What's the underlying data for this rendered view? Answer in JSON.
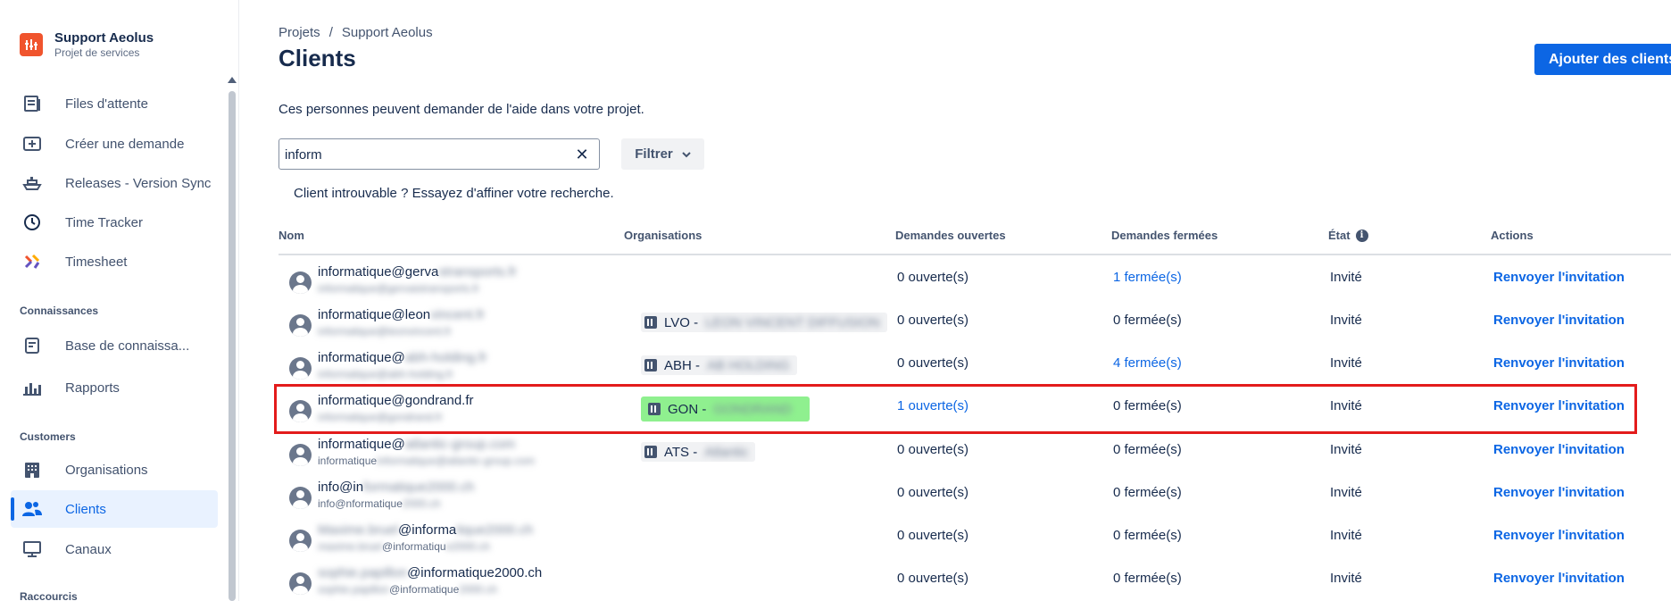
{
  "project": {
    "name": "Support Aeolus",
    "type": "Projet de services"
  },
  "nav": {
    "items_top": [
      {
        "label": "Files d'attente",
        "icon": "queue-icon"
      },
      {
        "label": "Créer une demande",
        "icon": "create-request-icon"
      },
      {
        "label": "Releases - Version Sync",
        "icon": "ship-icon"
      },
      {
        "label": "Time Tracker",
        "icon": "clock-icon"
      },
      {
        "label": "Timesheet",
        "icon": "timesheet-icon"
      }
    ],
    "section_knowledge": "Connaissances",
    "items_knowledge": [
      {
        "label": "Base de connaissa...",
        "icon": "knowledge-base-icon"
      },
      {
        "label": "Rapports",
        "icon": "reports-icon"
      }
    ],
    "section_customers": "Customers",
    "items_customers": [
      {
        "label": "Organisations",
        "icon": "building-icon"
      },
      {
        "label": "Clients",
        "icon": "users-icon"
      },
      {
        "label": "Canaux",
        "icon": "monitor-icon"
      }
    ],
    "section_shortcuts": "Raccourcis"
  },
  "breadcrumb": {
    "root": "Projets",
    "sep": "/",
    "current": "Support Aeolus"
  },
  "page": {
    "title": "Clients",
    "add_button": "Ajouter des clients",
    "description": "Ces personnes peuvent demander de l'aide dans votre projet.",
    "search_value": "inform",
    "filter_label": "Filtrer",
    "not_found": "Client introuvable ? Essayez d'affiner votre recherche."
  },
  "table": {
    "headers": {
      "name": "Nom",
      "orgs": "Organisations",
      "open": "Demandes ouvertes",
      "closed": "Demandes fermées",
      "state": "État",
      "actions": "Actions"
    },
    "rows": [
      {
        "name_visible": "informatique@gerva",
        "name_hidden": "stransports.fr",
        "email_hidden": "informatique@gervaistransports.fr",
        "org_code": "",
        "org_hidden": "",
        "open": "0 ouverte(s)",
        "open_link": false,
        "closed": "1 fermée(s)",
        "closed_link": true,
        "state": "Invité",
        "action": "Renvoyer l'invitation"
      },
      {
        "name_visible": "informatique@leon",
        "name_hidden": "vincent.fr",
        "email_hidden": "informatique@leonvincent.fr",
        "org_code": "LVO -",
        "org_hidden": "LEON VINCENT DIFFUSION",
        "open": "0 ouverte(s)",
        "open_link": false,
        "closed": "0 fermée(s)",
        "closed_link": false,
        "state": "Invité",
        "action": "Renvoyer l'invitation"
      },
      {
        "name_visible": "informatique@",
        "name_hidden": "abh-holding.fr",
        "email_hidden": "informatique@abh-holding.fr",
        "org_code": "ABH -",
        "org_hidden": "AB HOLDING",
        "open": "0 ouverte(s)",
        "open_link": false,
        "closed": "4 fermée(s)",
        "closed_link": true,
        "state": "Invité",
        "action": "Renvoyer l'invitation"
      },
      {
        "name_visible": "informatique@gondrand.fr",
        "name_hidden": "",
        "email_hidden": "informatique@gondrand.fr",
        "org_code": "GON -",
        "org_hidden": "GONDRAND",
        "open": "1 ouverte(s)",
        "open_link": true,
        "closed": "0 fermée(s)",
        "closed_link": false,
        "state": "Invité",
        "action": "Renvoyer l'invitation"
      },
      {
        "name_visible": "informatique@",
        "name_hidden": "atlantic-group.com",
        "email_hidden": "informatique@atlantic-group.com",
        "email_visible": "informatique",
        "org_code": "ATS -",
        "org_hidden": "Atlantic",
        "open": "0 ouverte(s)",
        "open_link": false,
        "closed": "0 fermée(s)",
        "closed_link": false,
        "state": "Invité",
        "action": "Renvoyer l'invitation"
      },
      {
        "name_visible": "info@in",
        "name_hidden": "formatique2000.ch",
        "email_visible": "info@",
        "email_mid": "nformatique",
        "email_hidden": "2000.ch",
        "org_code": "",
        "org_hidden": "",
        "open": "0 ouverte(s)",
        "open_link": false,
        "closed": "0 fermée(s)",
        "closed_link": false,
        "state": "Invité",
        "action": "Renvoyer l'invitation"
      },
      {
        "name_hidden_pre": "Maxime.bruel",
        "name_visible": "@informa",
        "name_hidden": "tique2000.ch",
        "email_hidden_pre": "maxime.bruel",
        "email_visible": "@informatiqu",
        "email_hidden": "e2000.ch",
        "org_code": "",
        "org_hidden": "",
        "open": "0 ouverte(s)",
        "open_link": false,
        "closed": "0 fermée(s)",
        "closed_link": false,
        "state": "Invité",
        "action": "Renvoyer l'invitation"
      },
      {
        "name_hidden_pre": "sophie.papillon",
        "name_visible": "@informatique2000.ch",
        "name_hidden": "",
        "email_hidden_pre": "sophie.papillon",
        "email_visible": "@informatique",
        "email_hidden": "2000.ch",
        "org_code": "",
        "org_hidden": "",
        "open": "0 ouverte(s)",
        "open_link": false,
        "closed": "0 fermée(s)",
        "closed_link": false,
        "state": "Invité",
        "action": "Renvoyer l'invitation"
      }
    ]
  },
  "colors": {
    "primary": "#0c66e4",
    "highlight": "#8ff08f",
    "annotation_box": "#e31b1b",
    "project_logo": "#f0542d"
  }
}
